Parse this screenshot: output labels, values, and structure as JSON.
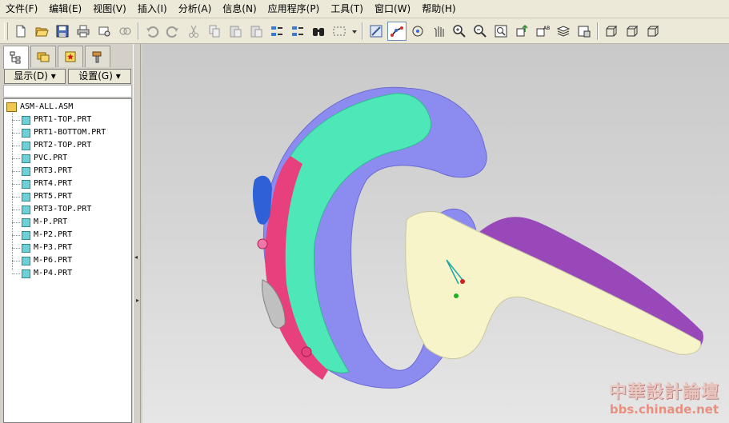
{
  "menu": [
    "文件(F)",
    "编辑(E)",
    "视图(V)",
    "插入(I)",
    "分析(A)",
    "信息(N)",
    "应用程序(P)",
    "工具(T)",
    "窗口(W)",
    "帮助(H)"
  ],
  "toolbar_icons": [
    "new-icon",
    "open-icon",
    "save-icon",
    "print-icon",
    "email-icon",
    "link-icon",
    "undo-icon",
    "redo-icon",
    "cut-icon",
    "copy-icon",
    "paste-icon",
    "paste-special-icon",
    "regenerate-icon",
    "regen-manager-icon",
    "find-icon",
    "select-box-icon",
    "dropdown-icon",
    "sketch-icon",
    "datum-display-icon",
    "spin-center-icon",
    "pan-icon",
    "zoom-in-icon",
    "zoom-out-icon",
    "refit-icon",
    "orient-icon",
    "view-manager-icon",
    "layers-icon",
    "saved-views-icon",
    "shading-icon",
    "hidden-line-icon",
    "no-hidden-icon"
  ],
  "sidebar": {
    "tabs": [
      "model-tree-tab",
      "folder-tab",
      "favorites-tab",
      "tools-tab"
    ],
    "display_button": "显示(D)",
    "settings_button": "设置(G)",
    "root": "ASM-ALL.ASM",
    "parts": [
      "PRT1-TOP.PRT",
      "PRT1-BOTTOM.PRT",
      "PRT2-TOP.PRT",
      "PVC.PRT",
      "PRT3.PRT",
      "PRT4.PRT",
      "PRT5.PRT",
      "PRT3-TOP.PRT",
      "M-P.PRT",
      "M-P2.PRT",
      "M-P3.PRT",
      "M-P6.PRT",
      "M-P4.PRT"
    ]
  },
  "watermark": {
    "title": "中華設計論壇",
    "url": "bbs.chinade.net"
  },
  "colors": {
    "teal": "#4ee8b8",
    "lavender": "#8c8cf0",
    "pink": "#e8407c",
    "cream": "#f6f4c8",
    "purple": "#9848b8",
    "blue": "#3060d8"
  }
}
